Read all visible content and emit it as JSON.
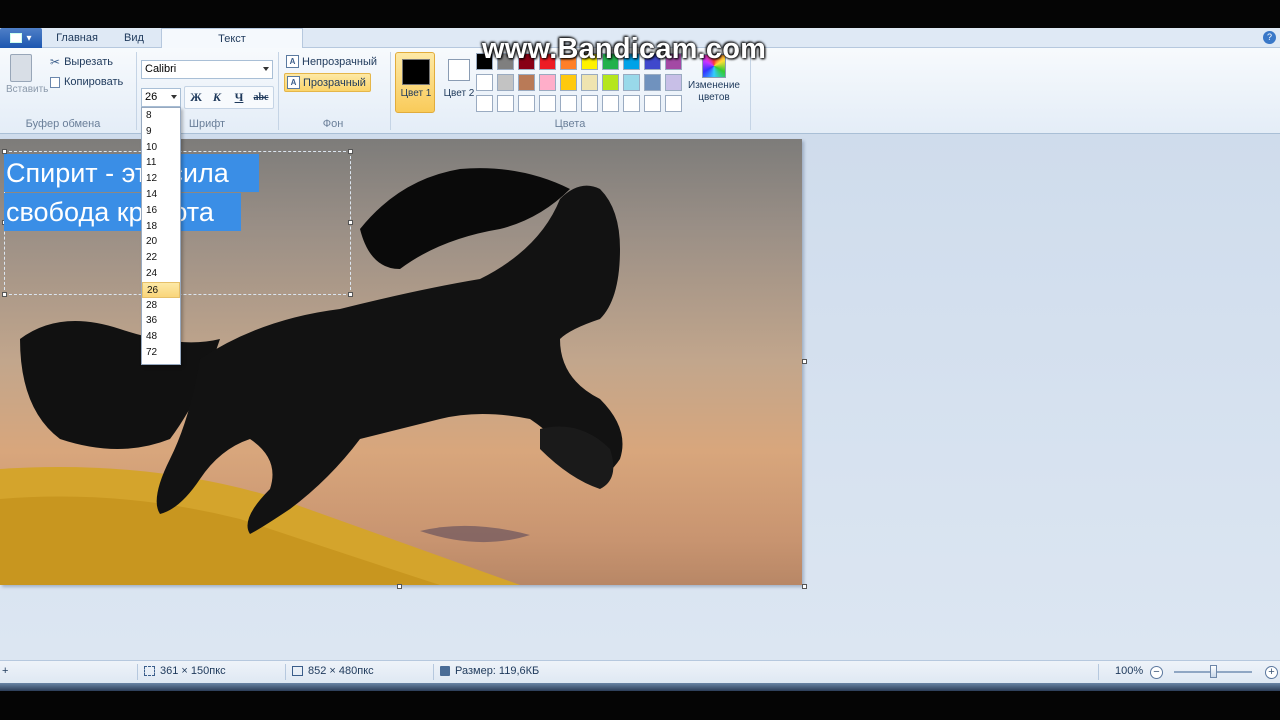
{
  "watermark": "www.Bandicam.com",
  "tabs": [
    "Главная",
    "Вид",
    "Текст"
  ],
  "ribbon": {
    "clipboard": {
      "paste": "Вставить",
      "cut": "Вырезать",
      "copy": "Копировать",
      "group": "Буфер обмена"
    },
    "font": {
      "family": "Calibri",
      "size": "26",
      "bold": "Ж",
      "italic": "К",
      "underline": "Ч",
      "strike": "abc",
      "group": "Шрифт"
    },
    "background": {
      "opaque": "Непрозрачный",
      "transparent": "Прозрачный",
      "group": "Фон"
    },
    "colors": {
      "color1": "Цвет 1",
      "color2": "Цвет 2",
      "edit": "Изменение цветов",
      "group": "Цвета",
      "palette": [
        "#000000",
        "#7f7f7f",
        "#880015",
        "#ed1c24",
        "#ff7f27",
        "#fff200",
        "#22b14c",
        "#00a2e8",
        "#3f48cc",
        "#a349a4",
        "#ffffff",
        "#c3c3c3",
        "#b97a57",
        "#ffaec9",
        "#ffc90e",
        "#efe4b0",
        "#b5e61d",
        "#99d9ea",
        "#7092be",
        "#c8bfe7",
        "#ffffff",
        "#ffffff",
        "#ffffff",
        "#ffffff",
        "#ffffff",
        "#ffffff",
        "#ffffff",
        "#ffffff",
        "#ffffff",
        "#ffffff"
      ]
    }
  },
  "canvas_text": {
    "line1": "Спирит - это сила",
    "line2": "свобода красота"
  },
  "font_sizes": [
    "8",
    "9",
    "10",
    "11",
    "12",
    "14",
    "16",
    "18",
    "20",
    "22",
    "24",
    "26",
    "28",
    "36",
    "48",
    "72"
  ],
  "selected_font_size": "26",
  "status": {
    "selection": "361 × 150пкс",
    "image_size": "852 × 480пкс",
    "file_size": "Размер: 119,6КБ",
    "zoom": "100%"
  }
}
